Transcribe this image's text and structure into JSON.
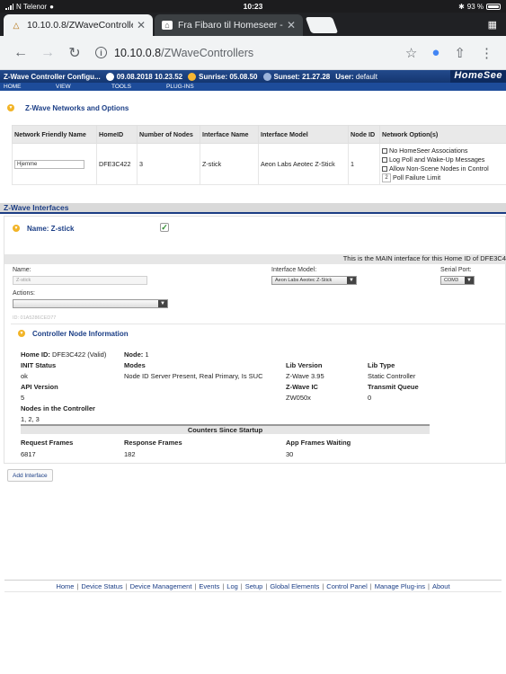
{
  "status_bar": {
    "carrier": "N Telenor",
    "time": "10:23",
    "battery": "93 %"
  },
  "browser": {
    "tabs": [
      {
        "title": "10.10.0.8/ZWaveControllers",
        "active": true
      },
      {
        "title": "Fra Fibaro til Homeseer - Ho",
        "active": false
      }
    ],
    "url_host": "10.10.0.8",
    "url_path": "/ZWaveControllers"
  },
  "header": {
    "title": "Z-Wave Controller Configu...",
    "datetime": "09.08.2018 10.23.52",
    "sunrise_label": "Sunrise:",
    "sunrise": "05.08.50",
    "sunset_label": "Sunset:",
    "sunset": "21.27.28",
    "user_label": "User:",
    "user": "default",
    "logo": "HomeSee"
  },
  "menu": [
    "HOME",
    "VIEW",
    "TOOLS",
    "PLUG-INS"
  ],
  "networks": {
    "title": "Z-Wave Networks and Options",
    "columns": [
      "Network Friendly Name",
      "HomeID",
      "Number of Nodes",
      "Interface Name",
      "Interface Model",
      "Node ID",
      "Network Option(s)"
    ],
    "row": {
      "name": "Hjemme",
      "home_id": "DFE3C422",
      "nodes": "3",
      "interface": "Z-stick",
      "model": "Aeon Labs Aeotec Z-Stick",
      "node_id": "1",
      "options": [
        "No HomeSeer Associations",
        "Log Poll and Wake-Up Messages",
        "Allow Non-Scene Nodes in Control"
      ],
      "poll_value": "2",
      "poll_label": "Poll Failure Limit"
    }
  },
  "interfaces": {
    "title": "Z-Wave Interfaces",
    "name_label": "Name: Z-stick",
    "main_note": "This is the MAIN interface for this Home ID of DFE3C4",
    "name_field_label": "Name:",
    "name_field_value": "Z-stick",
    "model_label": "Interface Model:",
    "model_value": "Aeon Labs Aeotec Z-Stick",
    "port_label": "Serial Port:",
    "port_value": "COM3",
    "actions_label": "Actions:",
    "id_text": "ID: 01A5286CED77"
  },
  "controller": {
    "title": "Controller Node Information",
    "home_id_label": "Home ID:",
    "home_id": "DFE3C422 (Valid)",
    "node_label": "Node:",
    "node": "1",
    "init_status_label": "INIT Status",
    "init_status": "ok",
    "modes_label": "Modes",
    "modes": "Node ID Server Present, Real Primary, Is SUC",
    "lib_version_label": "Lib Version",
    "lib_version": "Z-Wave 3.95",
    "lib_type_label": "Lib Type",
    "lib_type": "Static Controller",
    "api_version_label": "API Version",
    "api_version": "5",
    "zwave_ic_label": "Z-Wave IC",
    "zwave_ic": "ZW050x",
    "transmit_queue_label": "Transmit Queue",
    "transmit_queue": "0",
    "nodes_label": "Nodes in the Controller",
    "nodes": "1, 2, 3",
    "counters_title": "Counters Since Startup",
    "request_frames_label": "Request Frames",
    "request_frames": "6817",
    "response_frames_label": "Response Frames",
    "response_frames": "182",
    "app_frames_label": "App Frames Waiting",
    "app_frames": "30"
  },
  "add_interface": "Add Interface",
  "footer_links": [
    "Home",
    "Device Status",
    "Device Management",
    "Events",
    "Log",
    "Setup",
    "Global Elements",
    "Control Panel",
    "Manage Plug-ins",
    "About"
  ]
}
